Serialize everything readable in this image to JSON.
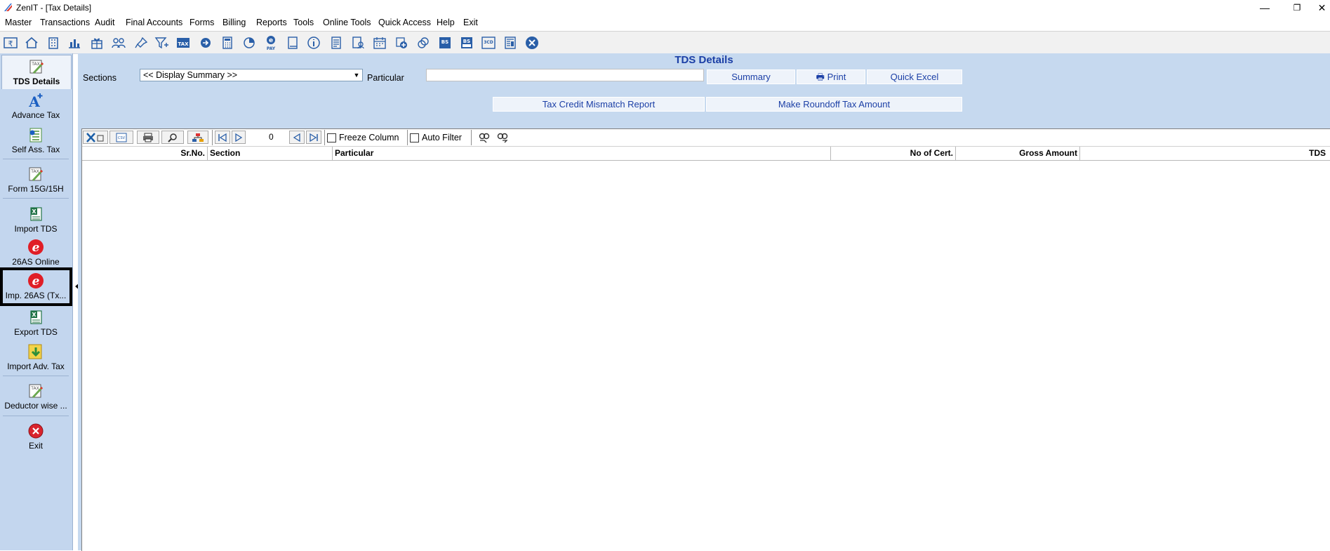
{
  "window": {
    "title": "ZenIT - [Tax Details]",
    "minimize_glyph": "—",
    "restore_glyph": "❐",
    "close_glyph": "✕"
  },
  "menu": [
    {
      "label": "Master"
    },
    {
      "label": "Transactions"
    },
    {
      "label": "Audit"
    },
    {
      "label": "Final Accounts"
    },
    {
      "label": "Forms"
    },
    {
      "label": "Billing"
    },
    {
      "label": "Reports"
    },
    {
      "label": "Tools"
    },
    {
      "label": "Online Tools"
    },
    {
      "label": "Quick Access"
    },
    {
      "label": "Help"
    },
    {
      "label": "Exit"
    }
  ],
  "toolbar_icons": [
    "rupee-card-icon",
    "home-icon",
    "building-icon",
    "bar-chart-icon",
    "gift-icon",
    "users-icon",
    "pin-icon",
    "filter-icon",
    "tax-icon",
    "arrow-circle-icon",
    "calculator-icon",
    "pie-icon",
    "e-pay-icon",
    "book-icon",
    "info-icon",
    "document-icon",
    "user-doc-icon",
    "calendar-icon",
    "add-circle-icon",
    "copy-circle-icon",
    "bs-icon",
    "bs-plus-icon",
    "3cd-icon",
    "form-icon",
    "close-circle-icon"
  ],
  "sidebar": {
    "items": [
      {
        "label": "TDS Details",
        "icon": "tax-pencil-icon",
        "active": true
      },
      {
        "label": "Advance Tax",
        "icon": "a-plus-icon"
      },
      {
        "label": "Self Ass. Tax",
        "icon": "calc-sheet-icon"
      },
      {
        "label": "Form 15G/15H",
        "icon": "tax-pencil-icon"
      },
      {
        "label": "Import TDS",
        "icon": "excel-icon"
      },
      {
        "label": "26AS Online",
        "icon": "e-icon"
      },
      {
        "label": "Imp. 26AS (Tx...",
        "icon": "e-icon"
      },
      {
        "label": "Export TDS",
        "icon": "excel-icon"
      },
      {
        "label": "Import Adv. Tax",
        "icon": "import-arrow-icon"
      },
      {
        "label": "Deductor wise ...",
        "icon": "tax-pencil-icon"
      },
      {
        "label": "Exit",
        "icon": "exit-icon"
      }
    ]
  },
  "main": {
    "title": "TDS Details",
    "sections_label": "Sections",
    "sections_value": "<< Display Summary >>",
    "particular_label": "Particular",
    "particular_value": "",
    "buttons": {
      "summary": "Summary",
      "print": "Print",
      "quick_excel": "Quick Excel",
      "tax_credit": "Tax Credit Mismatch Report",
      "roundoff": "Make Roundoff Tax Amount"
    }
  },
  "grid": {
    "record_count": "0",
    "freeze_column": "Freeze Column",
    "auto_filter": "Auto Filter",
    "columns": [
      "Sr.No.",
      "Section",
      "Particular",
      "No of Cert.",
      "Gross Amount",
      "TDS"
    ]
  },
  "colors": {
    "accent": "#1b3fa6",
    "panel": "#c6d9ef",
    "sidebar": "#c3d6ee",
    "e_red": "#e01e26"
  }
}
